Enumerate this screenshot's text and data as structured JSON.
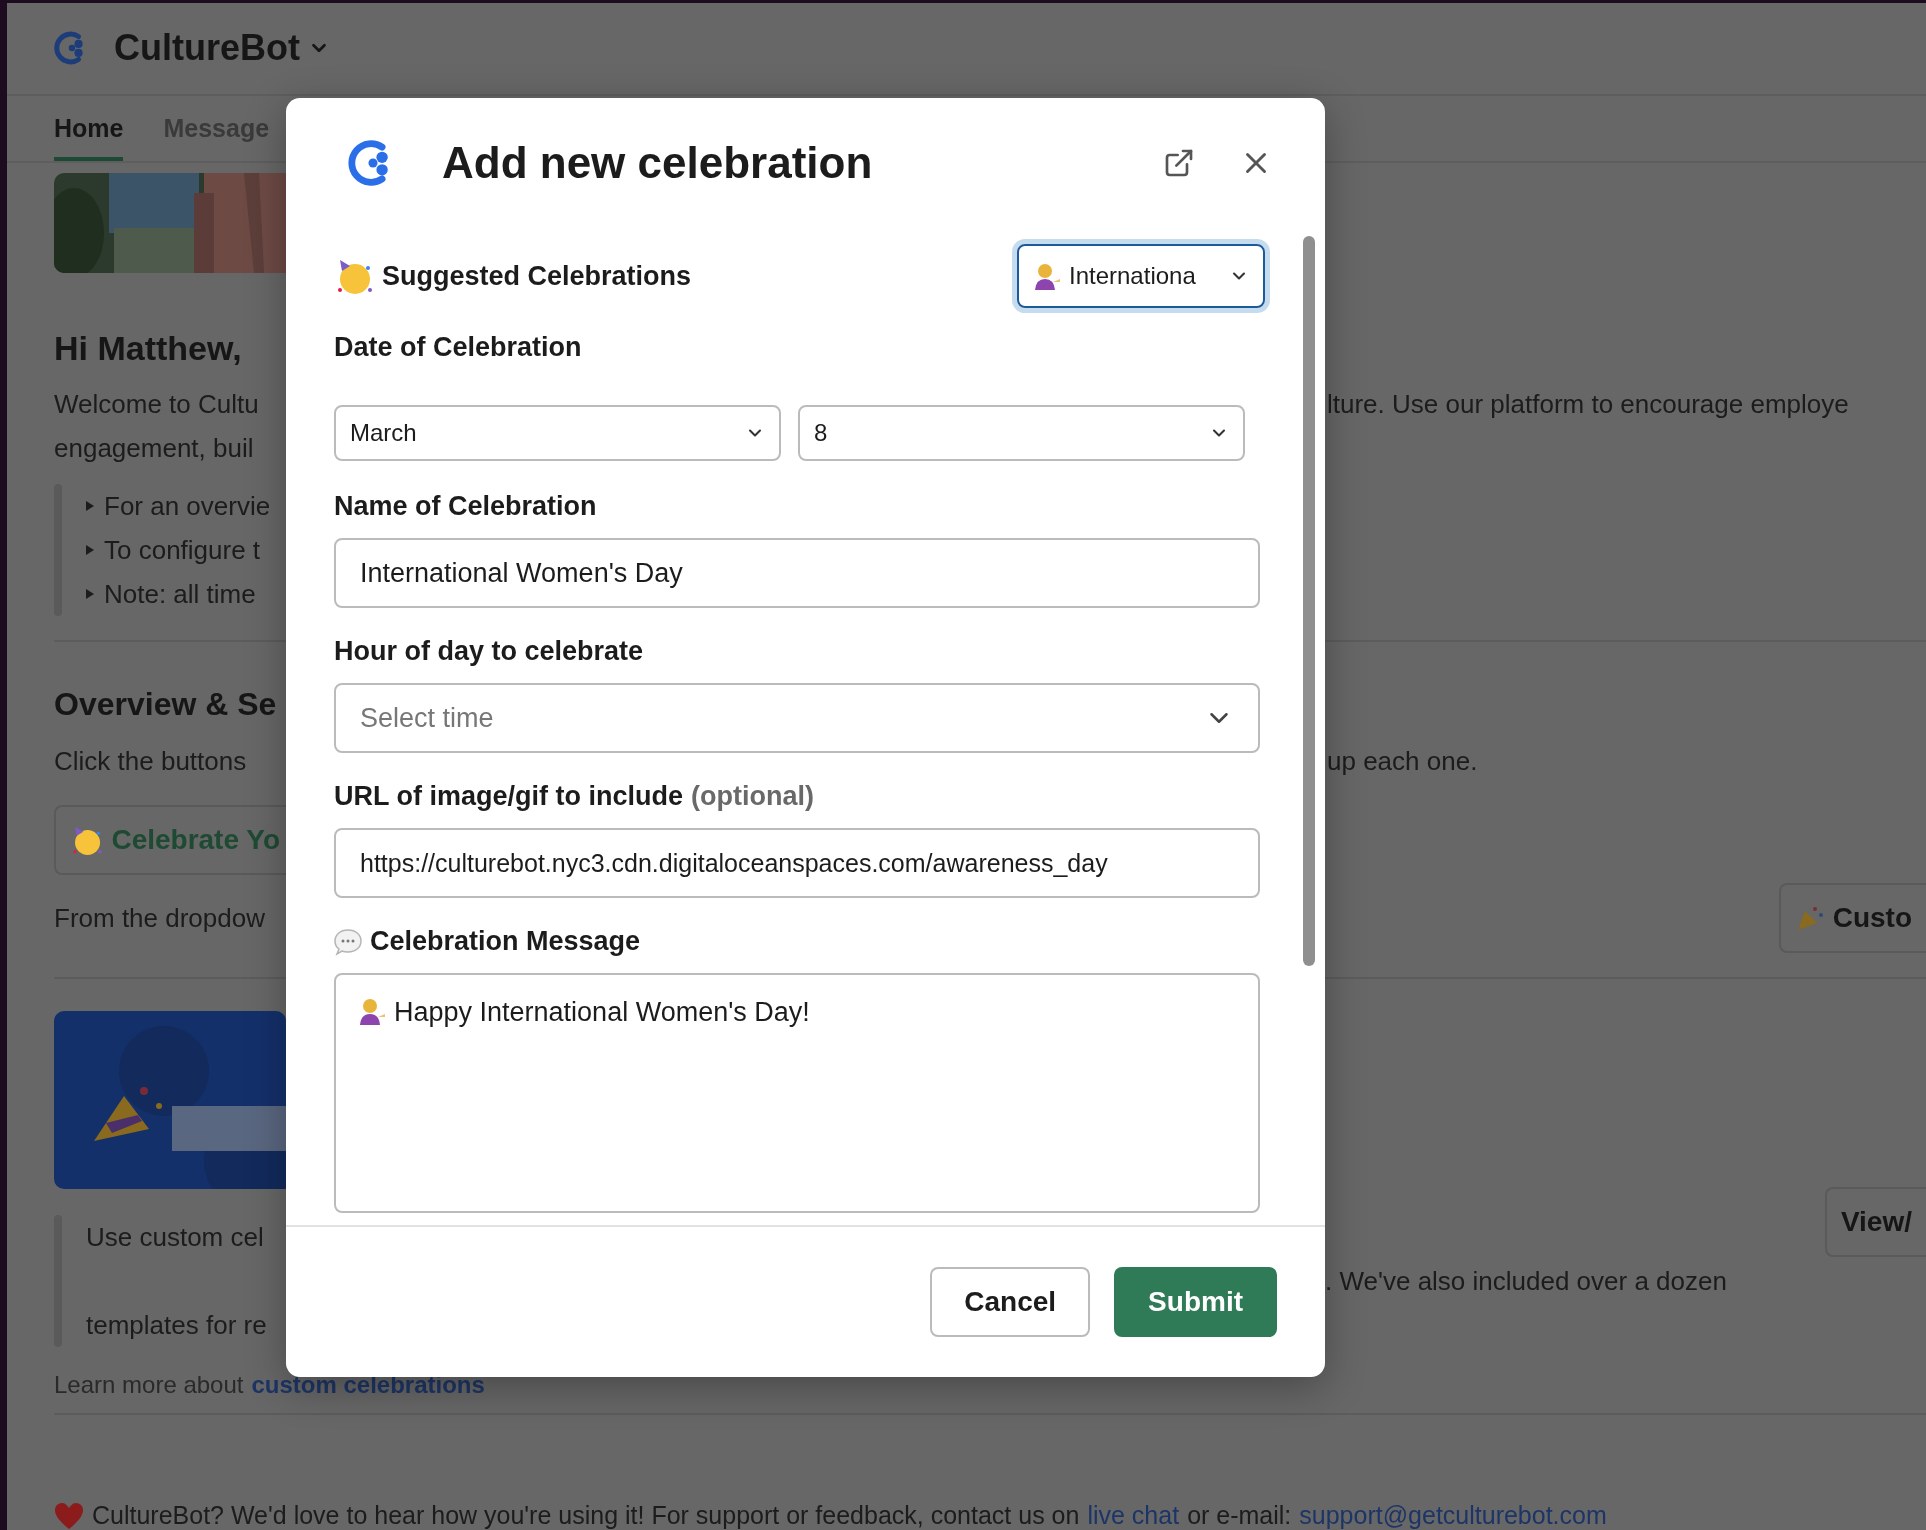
{
  "app": {
    "title": "CultureBot"
  },
  "tabs": [
    {
      "label": "Home",
      "selected": true
    },
    {
      "label": "Message",
      "selected": false
    }
  ],
  "home": {
    "greeting": "Hi Matthew,",
    "welcome_lines": [
      {
        "left": "Welcome to Cultu",
        "right": "lture. Use our platform to encourage employe"
      },
      {
        "left": "engagement, buil"
      }
    ],
    "notes": [
      "For an overvie",
      "To configure t",
      "Note: all time"
    ],
    "section_title": "Overview & Se",
    "section_intro": {
      "left": "Click the buttons",
      "right": "up each one."
    },
    "celebrate_button": "Celebrate Yo",
    "dropdown_text": "From the dropdow",
    "custom_button": "Custo",
    "custom_lines": [
      {
        "left": "Use custom cel",
        "right": ". We've also included over a dozen"
      },
      {
        "left": "templates for re"
      }
    ],
    "view_button": "View/",
    "learn_more": {
      "text": "Learn more about",
      "link": "custom celebrations"
    }
  },
  "footer": {
    "text": "CultureBot? We'd love to hear how you're using it! For support or feedback, contact us on",
    "link": "live chat",
    "text_2": "or e-mail:",
    "email": "support@getculturebot.com"
  },
  "modal": {
    "title": "Add new celebration",
    "suggested": {
      "label": "Suggested Celebrations",
      "value": "Internationa",
      "focused": true
    },
    "date": {
      "label": "Date of Celebration",
      "month": "March",
      "day": "8"
    },
    "name": {
      "label": "Name of Celebration",
      "value": "International Women's Day"
    },
    "hour": {
      "label": "Hour of day to celebrate",
      "placeholder": "Select time"
    },
    "image_url": {
      "label": "URL of image/gif to include",
      "hint": "(optional)",
      "value": "https://culturebot.nyc3.cdn.digitaloceanspaces.com/awareness_day"
    },
    "message": {
      "label": "Celebration Message",
      "value": "Happy International Women's Day!"
    },
    "buttons": [
      {
        "label": "Cancel",
        "kind": "secondary"
      },
      {
        "label": "Submit",
        "kind": "primary"
      }
    ]
  }
}
